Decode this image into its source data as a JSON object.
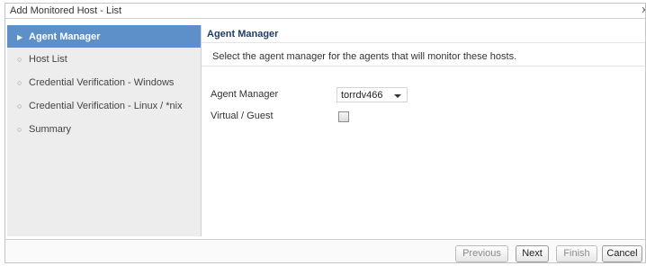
{
  "window": {
    "title": "Add Monitored Host - List",
    "close_label": "x"
  },
  "sidebar": {
    "items": [
      {
        "label": "Agent Manager",
        "marker": "▶",
        "active": true
      },
      {
        "label": "Host List",
        "marker": "○",
        "active": false
      },
      {
        "label": "Credential Verification - Windows",
        "marker": "○",
        "active": false
      },
      {
        "label": "Credential Verification - Linux / *nix",
        "marker": "○",
        "active": false
      },
      {
        "label": "Summary",
        "marker": "○",
        "active": false
      }
    ]
  },
  "main": {
    "header": "Agent Manager",
    "description": "Select the agent manager for the agents that will monitor these hosts.",
    "agent_manager": {
      "label": "Agent Manager",
      "value": "torrdv466"
    },
    "virtual_guest": {
      "label": "Virtual / Guest",
      "checked": false
    }
  },
  "footer": {
    "previous_label": "Previous",
    "next_label": "Next",
    "finish_label": "Finish",
    "cancel_label": "Cancel"
  },
  "colors": {
    "active_nav_bg": "#5d8fc9",
    "header_text": "#1f3e63",
    "sidebar_bg": "#ededed"
  }
}
